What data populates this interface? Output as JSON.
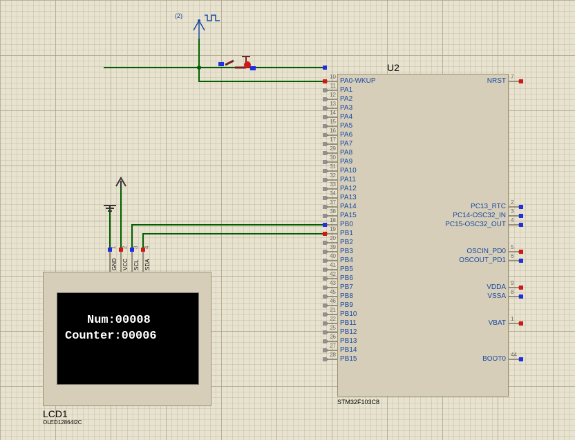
{
  "lcd": {
    "ref": "LCD1",
    "part": "OLED12864I2C",
    "line1": "Num:00008",
    "line2": "Counter:00006",
    "pins": [
      "GND",
      "VCC",
      "SCL",
      "SDA"
    ],
    "pin_nums": [
      "1",
      "2",
      "3",
      "4"
    ]
  },
  "mcu": {
    "ref": "U2",
    "part": "STM32F103C8",
    "left_pins": [
      {
        "num": "10",
        "label": "PA0-WKUP"
      },
      {
        "num": "11",
        "label": "PA1"
      },
      {
        "num": "12",
        "label": "PA2"
      },
      {
        "num": "13",
        "label": "PA3"
      },
      {
        "num": "14",
        "label": "PA4"
      },
      {
        "num": "15",
        "label": "PA5"
      },
      {
        "num": "16",
        "label": "PA6"
      },
      {
        "num": "17",
        "label": "PA7"
      },
      {
        "num": "29",
        "label": "PA8"
      },
      {
        "num": "30",
        "label": "PA9"
      },
      {
        "num": "31",
        "label": "PA10"
      },
      {
        "num": "32",
        "label": "PA11"
      },
      {
        "num": "33",
        "label": "PA12"
      },
      {
        "num": "34",
        "label": "PA13"
      },
      {
        "num": "37",
        "label": "PA14"
      },
      {
        "num": "38",
        "label": "PA15"
      },
      {
        "num": "18",
        "label": "PB0"
      },
      {
        "num": "19",
        "label": "PB1"
      },
      {
        "num": "20",
        "label": "PB2"
      },
      {
        "num": "39",
        "label": "PB3"
      },
      {
        "num": "40",
        "label": "PB4"
      },
      {
        "num": "41",
        "label": "PB5"
      },
      {
        "num": "42",
        "label": "PB6"
      },
      {
        "num": "43",
        "label": "PB7"
      },
      {
        "num": "45",
        "label": "PB8"
      },
      {
        "num": "46",
        "label": "PB9"
      },
      {
        "num": "21",
        "label": "PB10"
      },
      {
        "num": "22",
        "label": "PB11"
      },
      {
        "num": "25",
        "label": "PB12"
      },
      {
        "num": "26",
        "label": "PB13"
      },
      {
        "num": "27",
        "label": "PB14"
      },
      {
        "num": "28",
        "label": "PB15"
      }
    ],
    "right_pins": [
      {
        "row": 0,
        "num": "7",
        "label": "NRST"
      },
      {
        "row": 14,
        "num": "2",
        "label": "PC13_RTC"
      },
      {
        "row": 15,
        "num": "3",
        "label": "PC14-OSC32_IN"
      },
      {
        "row": 16,
        "num": "4",
        "label": "PC15-OSC32_OUT"
      },
      {
        "row": 19,
        "num": "5",
        "label": "OSCIN_PD0"
      },
      {
        "row": 20,
        "num": "6",
        "label": "OSCOUT_PD1"
      },
      {
        "row": 23,
        "num": "9",
        "label": "VDDA"
      },
      {
        "row": 24,
        "num": "8",
        "label": "VSSA"
      },
      {
        "row": 27,
        "num": "1",
        "label": "VBAT"
      },
      {
        "row": 31,
        "num": "44",
        "label": "BOOT0"
      }
    ]
  },
  "signal": "(2)",
  "colors": {
    "wire": "#005f00",
    "ind_blue": "#2030e0",
    "ind_red": "#d01818",
    "ind_gray": "#909090"
  }
}
